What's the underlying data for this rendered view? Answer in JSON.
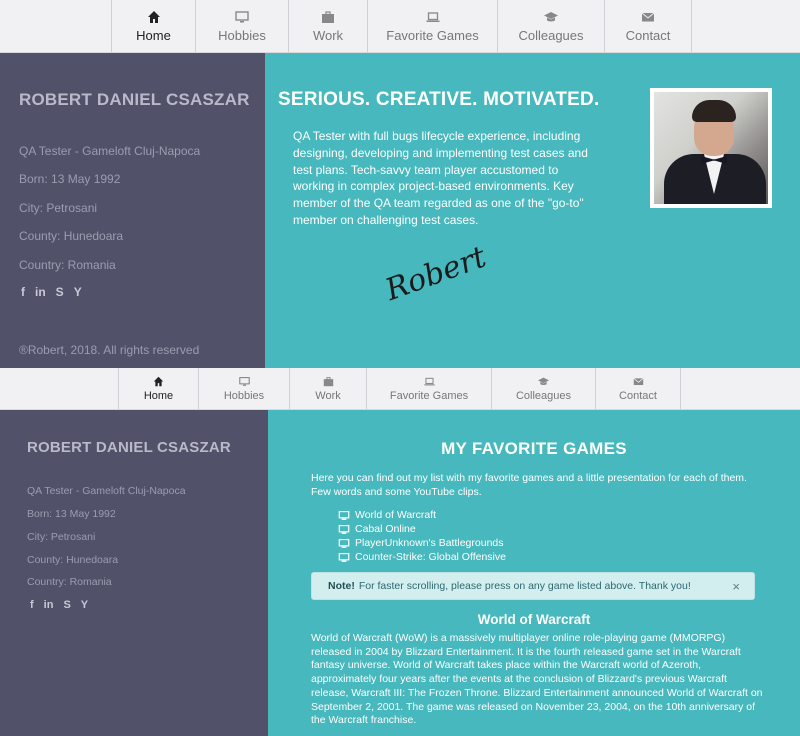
{
  "nav": [
    {
      "label": "Home",
      "icon": "home-icon",
      "active": true
    },
    {
      "label": "Hobbies",
      "icon": "monitor-icon"
    },
    {
      "label": "Work",
      "icon": "briefcase-icon"
    },
    {
      "label": "Favorite Games",
      "icon": "laptop-icon"
    },
    {
      "label": "Colleagues",
      "icon": "graduation-cap-icon"
    },
    {
      "label": "Contact",
      "icon": "envelope-icon"
    }
  ],
  "profile": {
    "name": "ROBERT DANIEL CSASZAR",
    "role": "QA Tester - Gameloft Cluj-Napoca",
    "born": "Born: 13 May 1992",
    "city": "City: Petrosani",
    "county": "County: Hunedoara",
    "country": "Country: Romania",
    "social": [
      {
        "glyph": "f",
        "icon": "facebook-icon"
      },
      {
        "glyph": "in",
        "icon": "linkedin-icon"
      },
      {
        "glyph": "S",
        "icon": "skype-icon"
      },
      {
        "glyph": "Y",
        "icon": "hacker-news-icon"
      }
    ],
    "copyright": "®Robert, 2018. All rights reserved"
  },
  "intro": {
    "headline": "SERIOUS. CREATIVE. MOTIVATED.",
    "about": "QA Tester with full bugs lifecycle experience, including designing, developing and implementing test cases and test plans. Tech-savvy team player accustomed to working in complex project-based environments. Key member of the QA team regarded as one of the \"go-to\" member on challenging test cases.",
    "signature": "Robert"
  },
  "games": {
    "title": "MY FAVORITE GAMES",
    "intro": "Here you can find out my list with my favorite games and a little presentation for each of them. Few words and some YouTube clips.",
    "list": [
      "World of Warcraft",
      "Cabal Online",
      "PlayerUnknown's Battlegrounds",
      "Counter-Strike: Global Offensive"
    ],
    "note_label": "Note!",
    "note_text": "For faster scrolling, please press on any game listed above. Thank you!",
    "close_glyph": "×",
    "wow_title": "World of Warcraft",
    "wow_text": "World of Warcraft (WoW) is a massively multiplayer online role-playing game (MMORPG) released in 2004 by Blizzard Entertainment. It is the fourth released game set in the Warcraft fantasy universe. World of Warcraft takes place within the Warcraft world of Azeroth, approximately four years after the events at the conclusion of Blizzard's previous Warcraft release, Warcraft III: The Frozen Throne. Blizzard Entertainment announced World of Warcraft on September 2, 2001. The game was released on November 23, 2004, on the 10th anniversary of the Warcraft franchise."
  }
}
